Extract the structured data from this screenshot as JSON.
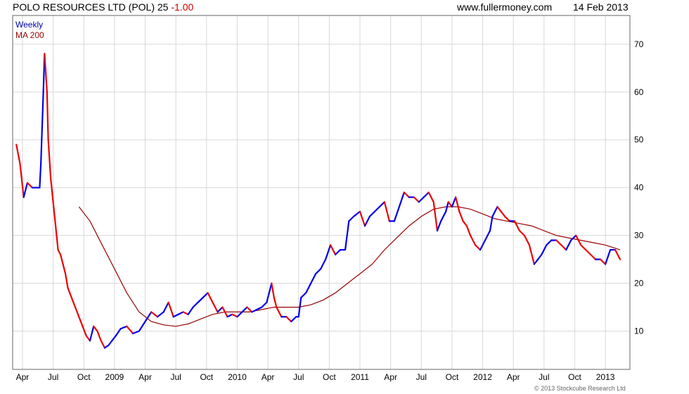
{
  "header": {
    "title": "POLO RESOURCES LTD (POL) 25",
    "change": "-1.00",
    "site": "www.fullermoney.com",
    "date": "14 Feb 2013"
  },
  "legend": {
    "period": "Weekly",
    "ma": "MA 200"
  },
  "credit": "© 2013 Stockcube Research Ltd",
  "colors": {
    "up": "#0000ee",
    "down": "#ee0000",
    "ma": "#990000",
    "grid": "#d8d8d8",
    "frame": "#666666"
  },
  "chart_data": {
    "type": "line",
    "title": "POLO RESOURCES LTD (POL) 25",
    "period": "Weekly",
    "xlabel": "",
    "ylabel": "",
    "xlim": [
      2008.17,
      2013.2
    ],
    "ylim": [
      2,
      76
    ],
    "y_ticks": [
      10,
      20,
      30,
      40,
      50,
      60,
      70
    ],
    "x_ticks": [
      {
        "label": "Apr",
        "x": 2008.25
      },
      {
        "label": "Jul",
        "x": 2008.5
      },
      {
        "label": "Oct",
        "x": 2008.75
      },
      {
        "label": "2009",
        "x": 2009.0
      },
      {
        "label": "Apr",
        "x": 2009.25
      },
      {
        "label": "Jul",
        "x": 2009.5
      },
      {
        "label": "Oct",
        "x": 2009.75
      },
      {
        "label": "2010",
        "x": 2010.0
      },
      {
        "label": "Apr",
        "x": 2010.25
      },
      {
        "label": "Jul",
        "x": 2010.5
      },
      {
        "label": "Oct",
        "x": 2010.75
      },
      {
        "label": "2011",
        "x": 2011.0
      },
      {
        "label": "Apr",
        "x": 2011.25
      },
      {
        "label": "Jul",
        "x": 2011.5
      },
      {
        "label": "Oct",
        "x": 2011.75
      },
      {
        "label": "2012",
        "x": 2012.0
      },
      {
        "label": "Apr",
        "x": 2012.25
      },
      {
        "label": "Jul",
        "x": 2012.5
      },
      {
        "label": "Oct",
        "x": 2012.75
      },
      {
        "label": "2013",
        "x": 2013.0
      }
    ],
    "grid": true,
    "series": [
      {
        "name": "Weekly",
        "note": "price line, colored blue when rising and red when falling",
        "points": [
          [
            2008.2,
            49
          ],
          [
            2008.23,
            45
          ],
          [
            2008.26,
            38
          ],
          [
            2008.29,
            41
          ],
          [
            2008.33,
            40
          ],
          [
            2008.36,
            40
          ],
          [
            2008.39,
            40
          ],
          [
            2008.4,
            45
          ],
          [
            2008.42,
            60
          ],
          [
            2008.43,
            68
          ],
          [
            2008.45,
            60
          ],
          [
            2008.46,
            50
          ],
          [
            2008.48,
            42
          ],
          [
            2008.5,
            37
          ],
          [
            2008.52,
            32
          ],
          [
            2008.54,
            27
          ],
          [
            2008.56,
            26
          ],
          [
            2008.58,
            24
          ],
          [
            2008.6,
            22
          ],
          [
            2008.62,
            19
          ],
          [
            2008.65,
            17
          ],
          [
            2008.68,
            15
          ],
          [
            2008.71,
            13
          ],
          [
            2008.74,
            11
          ],
          [
            2008.77,
            9
          ],
          [
            2008.8,
            8
          ],
          [
            2008.83,
            11
          ],
          [
            2008.86,
            10
          ],
          [
            2008.89,
            8
          ],
          [
            2008.92,
            6.5
          ],
          [
            2008.95,
            7
          ],
          [
            2008.98,
            8
          ],
          [
            2009.01,
            9
          ],
          [
            2009.05,
            10.5
          ],
          [
            2009.1,
            11
          ],
          [
            2009.15,
            9.5
          ],
          [
            2009.2,
            10
          ],
          [
            2009.25,
            12
          ],
          [
            2009.3,
            14
          ],
          [
            2009.35,
            13
          ],
          [
            2009.4,
            14
          ],
          [
            2009.44,
            16
          ],
          [
            2009.48,
            13
          ],
          [
            2009.52,
            13.5
          ],
          [
            2009.56,
            14
          ],
          [
            2009.6,
            13.5
          ],
          [
            2009.64,
            15
          ],
          [
            2009.68,
            16
          ],
          [
            2009.72,
            17
          ],
          [
            2009.76,
            18
          ],
          [
            2009.8,
            16
          ],
          [
            2009.84,
            14
          ],
          [
            2009.88,
            15
          ],
          [
            2009.92,
            13
          ],
          [
            2009.96,
            13.5
          ],
          [
            2010.0,
            13
          ],
          [
            2010.04,
            14
          ],
          [
            2010.08,
            15
          ],
          [
            2010.12,
            14
          ],
          [
            2010.16,
            14.5
          ],
          [
            2010.2,
            15
          ],
          [
            2010.24,
            16
          ],
          [
            2010.28,
            20
          ],
          [
            2010.3,
            17
          ],
          [
            2010.32,
            15
          ],
          [
            2010.36,
            13
          ],
          [
            2010.4,
            13
          ],
          [
            2010.44,
            12
          ],
          [
            2010.48,
            13
          ],
          [
            2010.5,
            13
          ],
          [
            2010.52,
            17
          ],
          [
            2010.56,
            18
          ],
          [
            2010.6,
            20
          ],
          [
            2010.64,
            22
          ],
          [
            2010.68,
            23
          ],
          [
            2010.72,
            25
          ],
          [
            2010.76,
            28
          ],
          [
            2010.8,
            26
          ],
          [
            2010.84,
            27
          ],
          [
            2010.88,
            27
          ],
          [
            2010.91,
            33
          ],
          [
            2010.95,
            34
          ],
          [
            2011.0,
            35
          ],
          [
            2011.04,
            32
          ],
          [
            2011.08,
            34
          ],
          [
            2011.12,
            35
          ],
          [
            2011.16,
            36
          ],
          [
            2011.2,
            37
          ],
          [
            2011.24,
            33
          ],
          [
            2011.28,
            33
          ],
          [
            2011.32,
            36
          ],
          [
            2011.36,
            39
          ],
          [
            2011.4,
            38
          ],
          [
            2011.44,
            38
          ],
          [
            2011.48,
            37
          ],
          [
            2011.52,
            38
          ],
          [
            2011.56,
            39
          ],
          [
            2011.6,
            37
          ],
          [
            2011.63,
            31
          ],
          [
            2011.66,
            33
          ],
          [
            2011.7,
            35
          ],
          [
            2011.72,
            37
          ],
          [
            2011.75,
            36
          ],
          [
            2011.78,
            38
          ],
          [
            2011.81,
            35
          ],
          [
            2011.84,
            33
          ],
          [
            2011.87,
            32
          ],
          [
            2011.9,
            30
          ],
          [
            2011.94,
            28
          ],
          [
            2011.98,
            27
          ],
          [
            2012.02,
            29
          ],
          [
            2012.06,
            31
          ],
          [
            2012.08,
            34
          ],
          [
            2012.12,
            36
          ],
          [
            2012.15,
            35
          ],
          [
            2012.18,
            34
          ],
          [
            2012.22,
            33
          ],
          [
            2012.26,
            33
          ],
          [
            2012.3,
            31
          ],
          [
            2012.34,
            30
          ],
          [
            2012.38,
            28
          ],
          [
            2012.42,
            24
          ],
          [
            2012.45,
            25
          ],
          [
            2012.48,
            26
          ],
          [
            2012.52,
            28
          ],
          [
            2012.56,
            29
          ],
          [
            2012.6,
            29
          ],
          [
            2012.64,
            28
          ],
          [
            2012.68,
            27
          ],
          [
            2012.72,
            29
          ],
          [
            2012.76,
            30
          ],
          [
            2012.8,
            28
          ],
          [
            2012.84,
            27
          ],
          [
            2012.88,
            26
          ],
          [
            2012.92,
            25
          ],
          [
            2012.96,
            25
          ],
          [
            2013.0,
            24
          ],
          [
            2013.04,
            27
          ],
          [
            2013.08,
            27
          ],
          [
            2013.12,
            25
          ]
        ]
      },
      {
        "name": "MA 200",
        "points": [
          [
            2008.71,
            36
          ],
          [
            2008.8,
            33
          ],
          [
            2008.9,
            28
          ],
          [
            2009.0,
            23
          ],
          [
            2009.1,
            18
          ],
          [
            2009.2,
            14
          ],
          [
            2009.3,
            12
          ],
          [
            2009.4,
            11.3
          ],
          [
            2009.5,
            11
          ],
          [
            2009.6,
            11.5
          ],
          [
            2009.7,
            12.5
          ],
          [
            2009.8,
            13.5
          ],
          [
            2009.9,
            14
          ],
          [
            2010.0,
            14
          ],
          [
            2010.1,
            14
          ],
          [
            2010.2,
            14.5
          ],
          [
            2010.3,
            15
          ],
          [
            2010.4,
            15
          ],
          [
            2010.5,
            15
          ],
          [
            2010.6,
            15.5
          ],
          [
            2010.7,
            16.5
          ],
          [
            2010.8,
            18
          ],
          [
            2010.9,
            20
          ],
          [
            2011.0,
            22
          ],
          [
            2011.1,
            24
          ],
          [
            2011.2,
            27
          ],
          [
            2011.3,
            29.5
          ],
          [
            2011.4,
            32
          ],
          [
            2011.5,
            34
          ],
          [
            2011.6,
            35.5
          ],
          [
            2011.7,
            36
          ],
          [
            2011.8,
            36
          ],
          [
            2011.9,
            35.5
          ],
          [
            2012.0,
            34.5
          ],
          [
            2012.1,
            33.5
          ],
          [
            2012.2,
            33
          ],
          [
            2012.3,
            32.5
          ],
          [
            2012.4,
            32
          ],
          [
            2012.5,
            31
          ],
          [
            2012.6,
            30
          ],
          [
            2012.7,
            29.5
          ],
          [
            2012.8,
            29
          ],
          [
            2012.9,
            28.5
          ],
          [
            2013.0,
            28
          ],
          [
            2013.12,
            27
          ]
        ]
      }
    ]
  }
}
